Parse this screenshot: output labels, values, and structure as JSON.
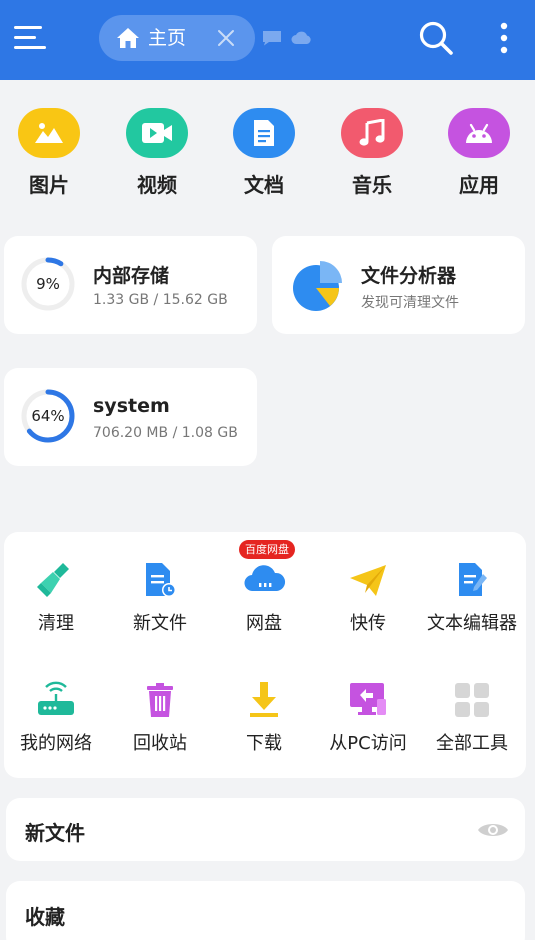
{
  "topbar": {
    "tab_label": "主页",
    "icons": [
      "menu-icon",
      "home-icon",
      "close-icon",
      "message-icon",
      "cloud-icon",
      "search-icon",
      "more-vertical-icon"
    ],
    "bg_color": "#2e77e5"
  },
  "categories": [
    {
      "label": "图片",
      "icon": "image-icon",
      "color": "#f9c614"
    },
    {
      "label": "视频",
      "icon": "video-icon",
      "color": "#22c8a0"
    },
    {
      "label": "文档",
      "icon": "document-icon",
      "color": "#2e8cf0"
    },
    {
      "label": "音乐",
      "icon": "music-icon",
      "color": "#f25a6e"
    },
    {
      "label": "应用",
      "icon": "android-icon",
      "color": "#c553e0"
    }
  ],
  "storage": {
    "internal": {
      "title": "内部存储",
      "used": "1.33 GB / 15.62 GB",
      "percent_text": "9%",
      "percent": 9
    },
    "system": {
      "title": "system",
      "used": "706.20 MB / 1.08 GB",
      "percent_text": "64%",
      "percent": 64
    }
  },
  "analyzer": {
    "title": "文件分析器",
    "subtitle": "发现可清理文件"
  },
  "tools": [
    {
      "label": "清理",
      "icon": "broom-icon"
    },
    {
      "label": "新文件",
      "icon": "new-file-icon"
    },
    {
      "label": "网盘",
      "icon": "cloud-drive-icon",
      "badge": "百度网盘"
    },
    {
      "label": "快传",
      "icon": "paper-plane-icon"
    },
    {
      "label": "文本编辑器",
      "icon": "text-editor-icon"
    },
    {
      "label": "我的网络",
      "icon": "router-icon"
    },
    {
      "label": "回收站",
      "icon": "trash-icon"
    },
    {
      "label": "下载",
      "icon": "download-icon"
    },
    {
      "label": "从PC访问",
      "icon": "pc-access-icon"
    },
    {
      "label": "全部工具",
      "icon": "grid-icon"
    }
  ],
  "sections": {
    "new_files": {
      "title": "新文件",
      "icon": "eye-icon"
    },
    "favorites": {
      "title": "收藏"
    }
  },
  "colors": {
    "accent": "#2e77e5",
    "ring_track": "#eeeeee",
    "ring_fill": "#2e77e5",
    "badge": "#e52521"
  }
}
